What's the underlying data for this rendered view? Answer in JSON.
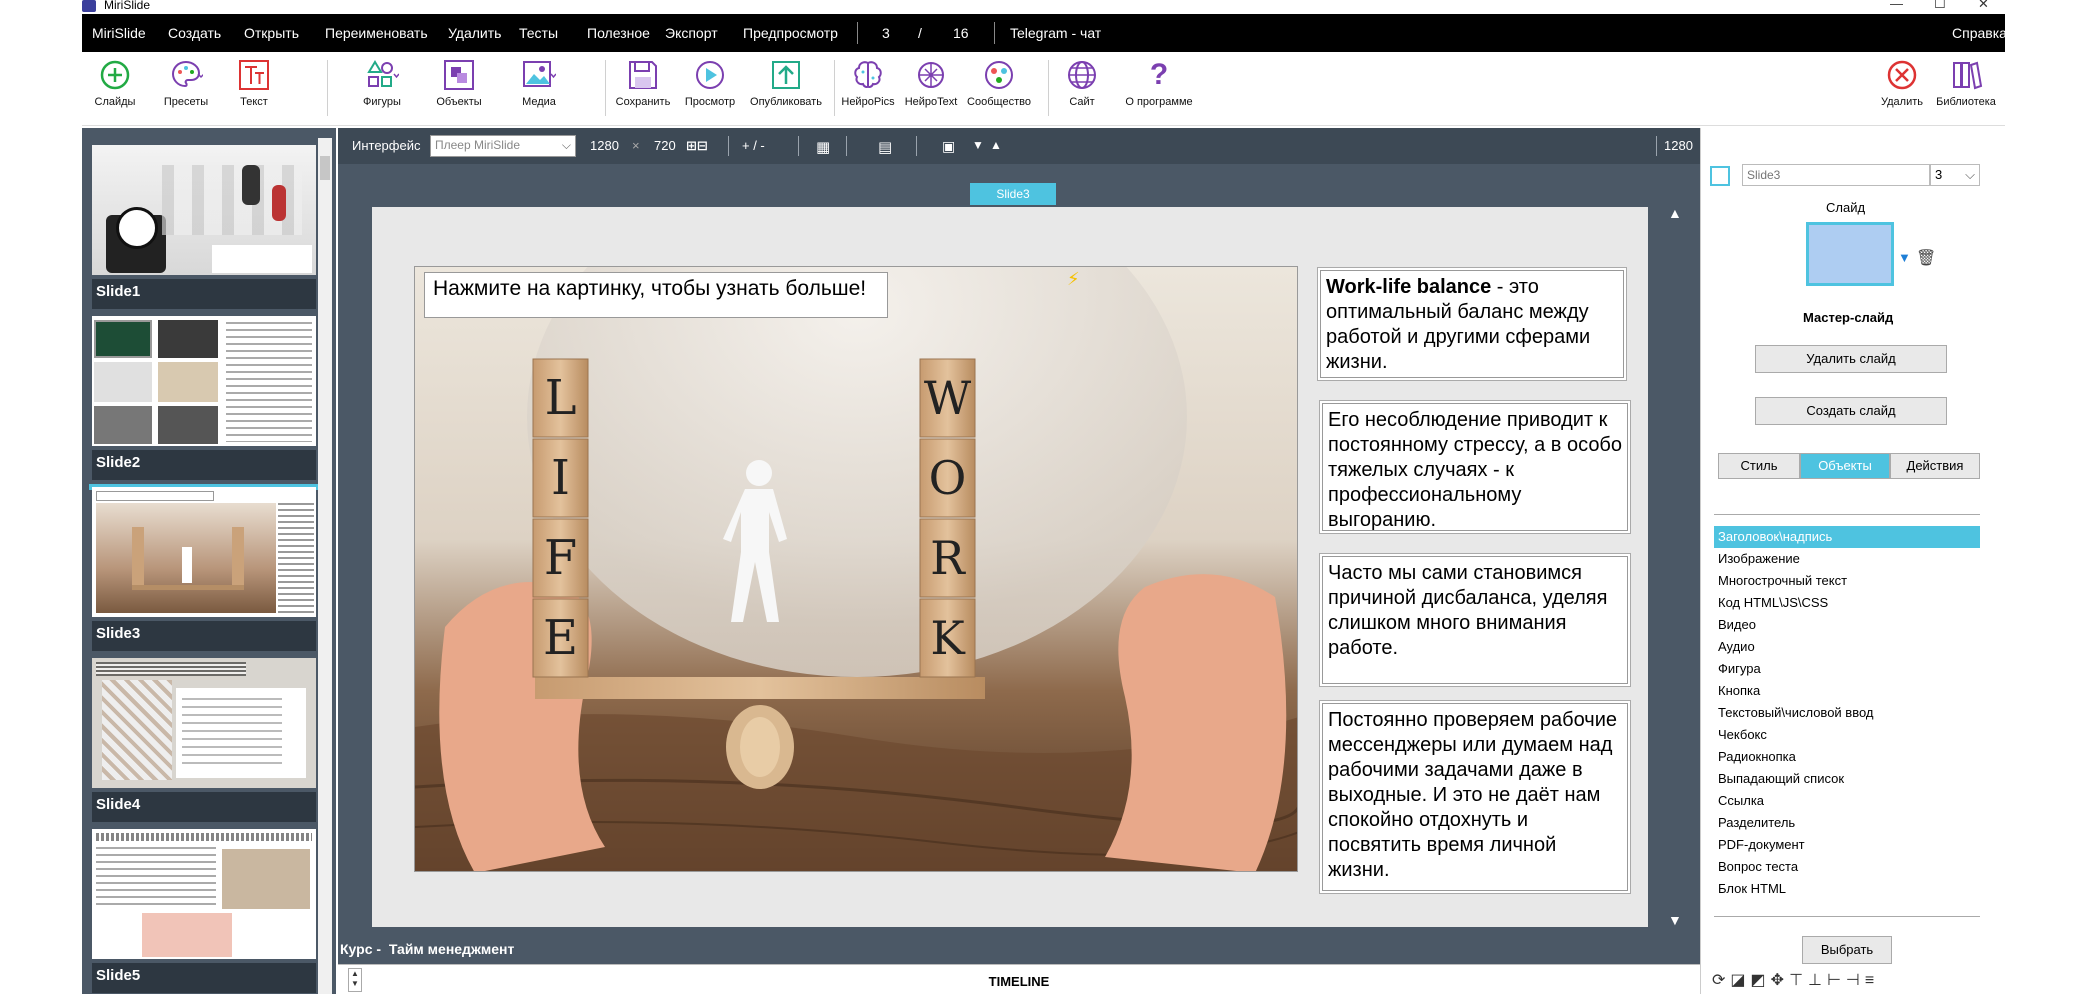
{
  "window": {
    "title": "MiriSlide"
  },
  "menu": {
    "items": [
      "MiriSlide",
      "Создать",
      "Открыть",
      "Переименовать",
      "Удалить",
      "Тесты",
      "Полезное",
      "Экспорт",
      "Предпросмотр"
    ],
    "page_current": "3",
    "page_sep": "/",
    "page_total": "16",
    "telegram": "Telegram - чат",
    "help": "Справка"
  },
  "toolbar": {
    "slides": "Слайды",
    "presets": "Пресеты",
    "text": "Текст",
    "shapes": "Фигуры",
    "objects": "Объекты",
    "media": "Медиа",
    "save": "Сохранить",
    "preview": "Просмотр",
    "publish": "Опубликовать",
    "neuropics": "НейроPics",
    "neurotext": "НейроText",
    "community": "Сообщество",
    "site": "Сайт",
    "about": "О программе",
    "delete": "Удалить",
    "library": "Библиотека"
  },
  "slides": [
    {
      "label": "Slide1"
    },
    {
      "label": "Slide2"
    },
    {
      "label": "Slide3"
    },
    {
      "label": "Slide4"
    },
    {
      "label": "Slide5"
    }
  ],
  "editor": {
    "interface_label": "Интерфейс",
    "player_placeholder": "Плеер MiriSlide",
    "width": "1280",
    "times": "×",
    "height": "720",
    "zoom": "+ / -",
    "right_width": "1280",
    "slide_tag": "Slide3",
    "course_prefix": "Курс -",
    "course_name": "Тайм менеджмент",
    "timeline": "TIMELINE"
  },
  "slide_content": {
    "hint": "Нажмите на картинку, чтобы узнать больше!",
    "box1_bold": "Work-life balance",
    "box1_rest": " - это оптимальный баланс между работой и другими сферами жизни.",
    "box2": "Его несоблюдение приводит к постоянному стрессу, а в особо тяжелых случаях - к профессиональному выгоранию.",
    "box3": "Часто мы сами становимся причиной дисбаланса, уделяя слишком много внимания работе.",
    "box4": "Постоянно проверяем рабочие мессенджеры или думаем над рабочими задачами даже в выходные. И это не даёт нам спокойно отдохнуть и посвятить время личной жизни.",
    "block_left": [
      "L",
      "I",
      "F",
      "E"
    ],
    "block_right": [
      "W",
      "O",
      "R",
      "K"
    ]
  },
  "props": {
    "slide_name_placeholder": "Slide3",
    "slide_number": "3",
    "slide_label": "Слайд",
    "master_slide": "Мастер-слайд",
    "delete_slide": "Удалить слайд",
    "create_slide": "Создать слайд",
    "tabs": [
      "Стиль",
      "Объекты",
      "Действия"
    ],
    "objects": [
      "Заголовок\\надпись",
      "Изображение",
      "Многострочный текст",
      "Код HTML\\JS\\CSS",
      "Видео",
      "Аудио",
      "Фигура",
      "Кнопка",
      "Текстовый\\числовой ввод",
      "Чекбокс",
      "Радиокнопка",
      "Выпадающий список",
      "Ссылка",
      "Разделитель",
      "PDF-документ",
      "Вопрос теста",
      "Блок HTML"
    ],
    "choose": "Выбрать"
  },
  "colors": {
    "accent": "#4ec3e0",
    "panel": "#4b5866",
    "menubar": "#000000",
    "toolbar_icon": "#7b3fb0"
  }
}
